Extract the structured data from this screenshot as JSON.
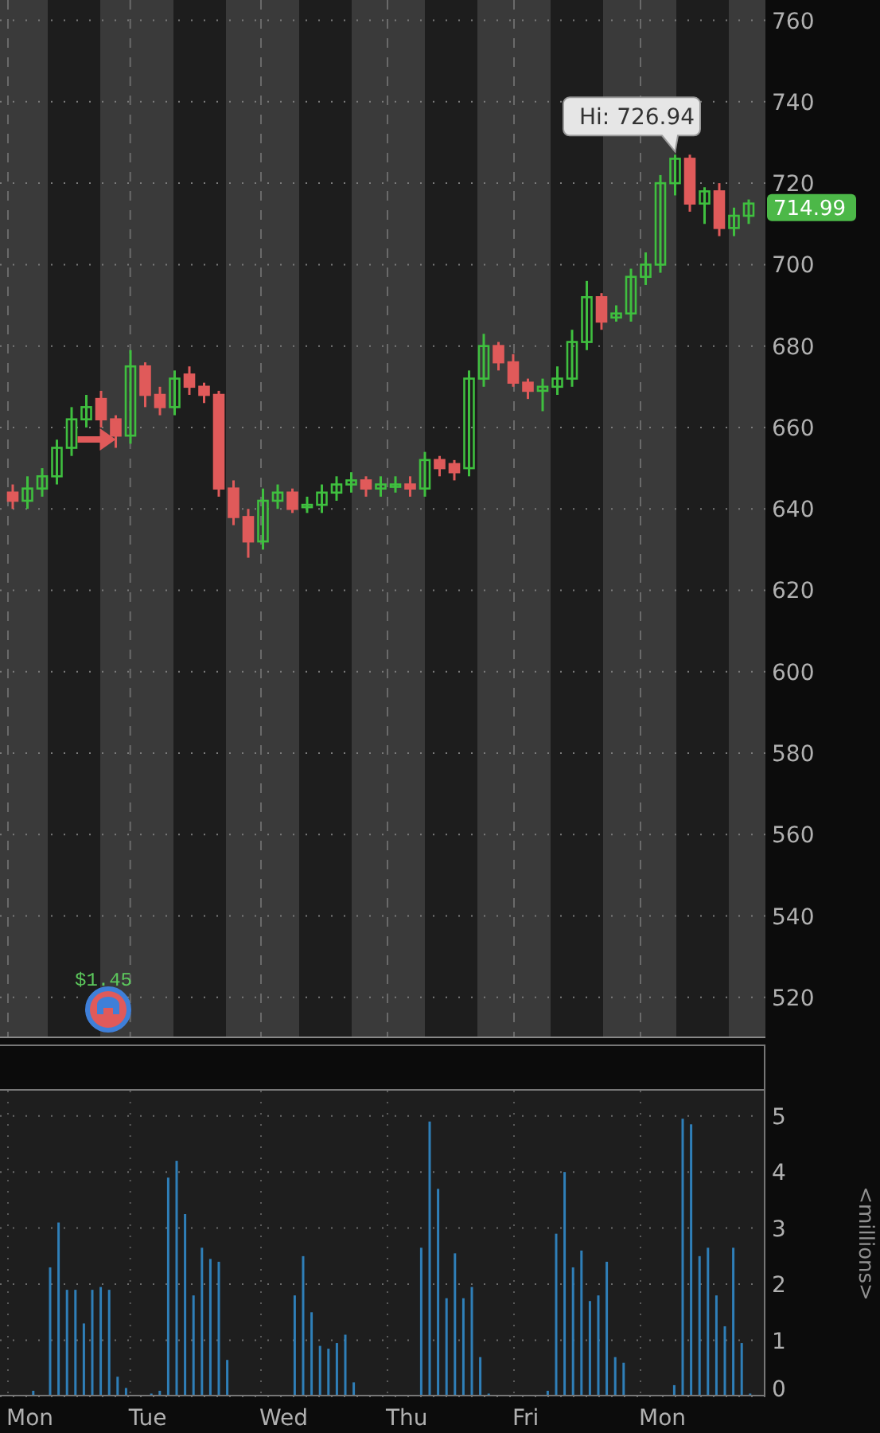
{
  "price_chart": {
    "chart_data": {
      "type": "candlestick",
      "grid": true,
      "ylim": [
        510,
        765
      ],
      "yticks": [
        520,
        540,
        560,
        580,
        600,
        620,
        640,
        660,
        680,
        700,
        720,
        740,
        760
      ],
      "ohlc": [
        [
          644,
          646,
          640,
          642
        ],
        [
          642,
          648,
          640,
          645
        ],
        [
          645,
          650,
          643,
          648
        ],
        [
          648,
          657,
          646,
          655
        ],
        [
          655,
          665,
          653,
          662
        ],
        [
          662,
          668,
          660,
          665
        ],
        [
          667,
          669,
          660,
          662
        ],
        [
          662,
          663,
          655,
          658
        ],
        [
          658,
          679,
          656,
          675
        ],
        [
          675,
          676,
          665,
          668
        ],
        [
          668,
          670,
          663,
          665
        ],
        [
          665,
          674,
          663,
          672
        ],
        [
          673,
          675,
          668,
          670
        ],
        [
          670,
          671,
          666,
          668
        ],
        [
          668,
          669,
          643,
          645
        ],
        [
          645,
          647,
          636,
          638
        ],
        [
          638,
          640,
          628,
          632
        ],
        [
          632,
          645,
          630,
          642
        ],
        [
          642,
          646,
          640,
          644
        ],
        [
          644,
          645,
          639,
          640
        ],
        [
          641,
          643,
          639,
          641
        ],
        [
          641,
          646,
          639,
          644
        ],
        [
          644,
          648,
          642,
          646
        ],
        [
          646,
          649,
          644,
          647
        ],
        [
          647,
          648,
          643,
          645
        ],
        [
          645,
          648,
          643,
          646
        ],
        [
          646,
          648,
          644,
          646
        ],
        [
          646,
          648,
          643,
          645
        ],
        [
          645,
          654,
          643,
          652
        ],
        [
          652,
          653,
          648,
          650
        ],
        [
          651,
          652,
          647,
          649
        ],
        [
          650,
          674,
          648,
          672
        ],
        [
          672,
          683,
          670,
          680
        ],
        [
          680,
          681,
          674,
          676
        ],
        [
          676,
          678,
          670,
          671
        ],
        [
          671,
          672,
          667,
          669
        ],
        [
          669,
          672,
          664,
          670
        ],
        [
          670,
          675,
          668,
          672
        ],
        [
          672,
          684,
          670,
          681
        ],
        [
          681,
          696,
          679,
          692
        ],
        [
          692,
          693,
          684,
          686
        ],
        [
          687,
          690,
          686,
          688
        ],
        [
          688,
          699,
          686,
          697
        ],
        [
          697,
          703,
          695,
          700
        ],
        [
          700,
          722,
          698,
          720
        ],
        [
          720,
          727,
          717,
          726
        ],
        [
          726,
          727,
          713,
          715
        ],
        [
          715,
          719,
          710,
          718
        ],
        [
          718,
          720,
          707,
          709
        ],
        [
          709,
          714,
          707,
          712
        ],
        [
          712,
          716,
          710,
          715
        ]
      ],
      "annotations": [
        "Hi: 726.94"
      ]
    },
    "last_price": "714.99",
    "event": {
      "amount": "$1.45"
    }
  },
  "volume_chart": {
    "unit_label": "<millions>",
    "day_labels": [
      "Mon",
      "Tue",
      "Wed",
      "Thu",
      "Fri",
      "Mon"
    ],
    "chart_data": {
      "type": "bar",
      "grid": true,
      "ylim": [
        0,
        5.45
      ],
      "yticks": [
        0,
        1,
        2,
        3,
        4,
        5
      ],
      "values": [
        0,
        0,
        0,
        0.1,
        0,
        2.3,
        3.1,
        1.9,
        1.9,
        1.3,
        1.9,
        1.95,
        1.9,
        0.35,
        0.15,
        0,
        0,
        0.05,
        0.1,
        3.9,
        4.2,
        3.25,
        1.8,
        2.65,
        2.45,
        2.4,
        0.65,
        0,
        0,
        0,
        0,
        0,
        0,
        0,
        1.8,
        2.5,
        1.5,
        0.9,
        0.85,
        0.95,
        1.1,
        0.25,
        0,
        0,
        0,
        0,
        0,
        0,
        0,
        2.65,
        4.9,
        3.7,
        1.75,
        2.55,
        1.75,
        1.95,
        0.7,
        0.05,
        0,
        0,
        0,
        0,
        0,
        0,
        0.1,
        2.9,
        4.0,
        2.3,
        2.6,
        1.7,
        1.8,
        2.4,
        0.7,
        0.6,
        0,
        0,
        0,
        0,
        0,
        0.2,
        4.95,
        4.85,
        2.5,
        2.65,
        1.8,
        1.25,
        2.65,
        0.95,
        0.05,
        0
      ]
    }
  }
}
